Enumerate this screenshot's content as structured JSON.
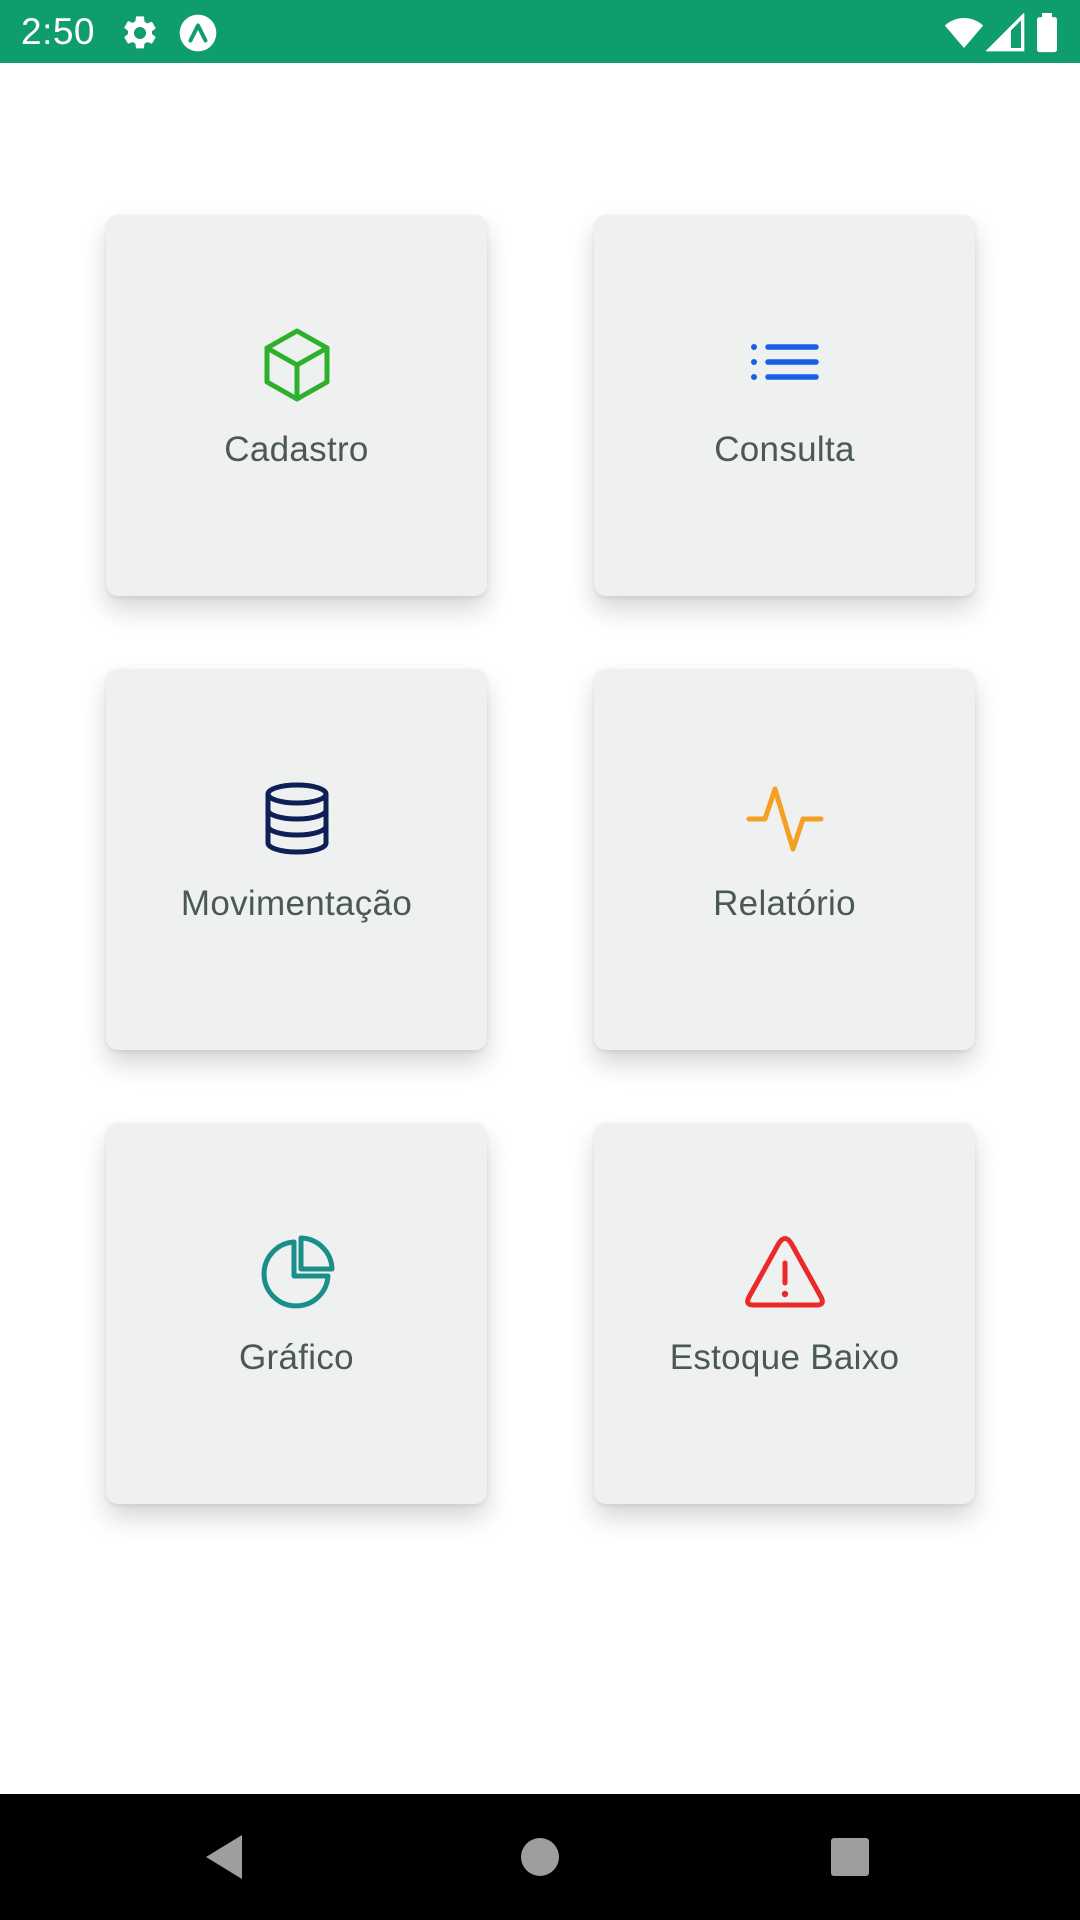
{
  "status_bar": {
    "time": "2:50",
    "background": "#0f9d6b",
    "icons": [
      "settings-gear-icon",
      "expo-app-icon",
      "wifi-icon",
      "cell-signal-icon",
      "battery-icon"
    ]
  },
  "menu": {
    "items": [
      {
        "label": "Cadastro",
        "icon": "cube-icon",
        "color": "#2db12d"
      },
      {
        "label": "Consulta",
        "icon": "list-icon",
        "color": "#1560e8"
      },
      {
        "label": "Movimentação",
        "icon": "database-icon",
        "color": "#0d1f55"
      },
      {
        "label": "Relatório",
        "icon": "activity-icon",
        "color": "#f5a023"
      },
      {
        "label": "Gráfico",
        "icon": "pie-chart-icon",
        "color": "#1a8f8a"
      },
      {
        "label": "Estoque Baixo",
        "icon": "alert-triangle-icon",
        "color": "#ea2a2a"
      }
    ]
  },
  "nav_bar": {
    "buttons": [
      "back-icon",
      "home-icon",
      "recents-icon"
    ]
  }
}
